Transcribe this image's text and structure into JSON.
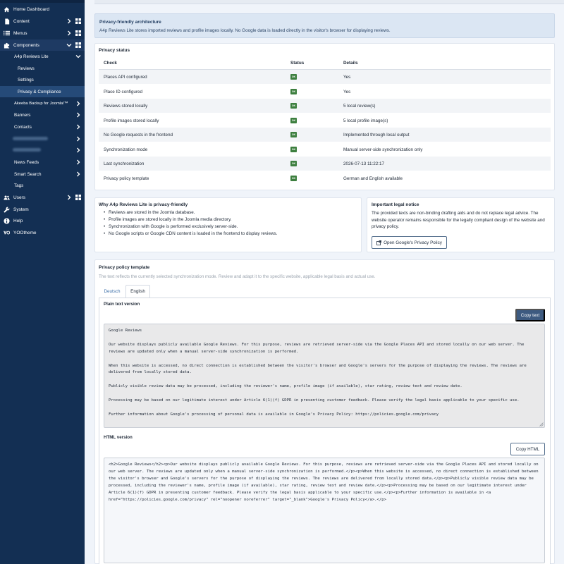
{
  "sidebar": {
    "items": [
      {
        "id": "home",
        "label": "Home Dashboard",
        "icon": "home-icon"
      },
      {
        "id": "content",
        "label": "Content",
        "icon": "file-icon"
      },
      {
        "id": "menus",
        "label": "Menus",
        "icon": "list-icon"
      },
      {
        "id": "components",
        "label": "Components",
        "icon": "puzzle-icon"
      }
    ],
    "a4p": "A4p Reviews Lite",
    "a4p_sub": [
      "Reviews",
      "Settings",
      "Privacy & Compliance"
    ],
    "components_sub": [
      "Akeeba Backup for Joomla!™",
      "Banners",
      "Contacts",
      "",
      "",
      "News Feeds",
      "Smart Search",
      "Tags"
    ],
    "bottom": [
      {
        "id": "users",
        "label": "Users",
        "icon": "users-icon"
      },
      {
        "id": "system",
        "label": "System",
        "icon": "wrench-icon"
      },
      {
        "id": "help",
        "label": "Help",
        "icon": "info-icon"
      },
      {
        "id": "yootheme",
        "label": "YOOtheme",
        "icon": "yootheme-icon"
      }
    ]
  },
  "notice": {
    "title": "Privacy-friendly architecture",
    "text": "A4p Reviews Lite stores imported reviews and profile images locally. No Google data is loaded directly in the visitor's browser for displaying reviews."
  },
  "status": {
    "title": "Privacy status",
    "headers": [
      "Check",
      "Status",
      "Details"
    ],
    "ok_label": "OK",
    "rows": [
      {
        "check": "Places API configured",
        "details": "Yes"
      },
      {
        "check": "Place ID configured",
        "details": "Yes"
      },
      {
        "check": "Reviews stored locally",
        "details": "5 local review(s)"
      },
      {
        "check": "Profile images stored locally",
        "details": "5 local profile image(s)"
      },
      {
        "check": "No Google requests in the frontend",
        "details": "Implemented through local output"
      },
      {
        "check": "Synchronization mode",
        "details": "Manual server-side synchronization only"
      },
      {
        "check": "Last synchronization",
        "details": "2026-07-13 11:22:17"
      },
      {
        "check": "Privacy policy template",
        "details": "German and English available"
      }
    ]
  },
  "why": {
    "title": "Why A4p Reviews Lite is privacy-friendly",
    "items": [
      "Reviews are stored in the Joomla database.",
      "Profile images are stored locally in the Joomla media directory.",
      "Synchronization with Google is performed exclusively server-side.",
      "No Google scripts or Google CDN content is loaded in the frontend to display reviews."
    ]
  },
  "legal": {
    "title": "Important legal notice",
    "text": "The provided texts are non-binding drafting aids and do not replace legal advice. The website operator remains responsible for the legally compliant design of the website and privacy policy.",
    "button": "Open Google's Privacy Policy"
  },
  "template": {
    "title": "Privacy policy template",
    "subtitle": "The text reflects the currently selected synchronization mode. Review and adapt it to the specific website, applicable legal basis and actual use.",
    "tabs": [
      "Deutsch",
      "English"
    ],
    "plain_label": "Plain text version",
    "copy_text": "Copy text",
    "plain": "Google Reviews\n\nOur website displays publicly available Google Reviews. For this purpose, reviews are retrieved server-side via the Google Places API and stored locally on our web server. The reviews are updated only when a manual server-side synchronization is performed.\n\nWhen this website is accessed, no direct connection is established between the visitor's browser and Google's servers for the purpose of displaying the reviews. The reviews are delivered from locally stored data.\n\nPublicly visible review data may be processed, including the reviewer's name, profile image (if available), star rating, review text and review date.\n\nProcessing may be based on our legitimate interest under Article 6(1)(f) GDPR in presenting customer feedback. Please verify the legal basis applicable to your specific use.\n\nFurther information about Google's processing of personal data is available in Google's Privacy Policy: https://policies.google.com/privacy",
    "html_label": "HTML version",
    "copy_html": "Copy HTML",
    "html": "<h2>Google Reviews</h2><p>Our website displays publicly available Google Reviews. For this purpose, reviews are retrieved server-side via the Google Places API and stored locally on our web server. The reviews are updated only when a manual server-side synchronization is performed.</p><p>When this website is accessed, no direct connection is established between the visitor's browser and Google's servers for the purpose of displaying the reviews. The reviews are delivered from locally stored data.</p><p>Publicly visible review data may be processed, including the reviewer's name, profile image (if available), star rating, review text and review date.</p><p>Processing may be based on our legitimate interest under Article 6(1)(f) GDPR in presenting customer feedback. Please verify the legal basis applicable to your specific use.</p><p>Further information is available in <a href=\"https://policies.google.com/privacy\" rel=\"noopener noreferrer\" target=\"_blank\">Google's Privacy Policy</a>.</p>"
  },
  "colors": {
    "sidebar": "#132f53",
    "ok_badge": "#3d7f3f",
    "primary_button": "#3d5a80",
    "notice_bg": "#dbe6f3"
  }
}
